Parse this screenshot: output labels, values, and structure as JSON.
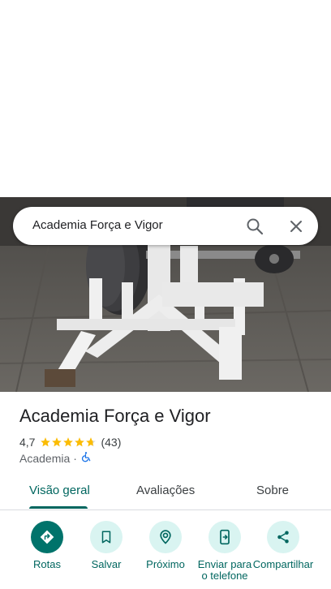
{
  "search": {
    "query": "Academia Força e Vigor"
  },
  "place": {
    "name": "Academia Força e Vigor",
    "rating": "4,7",
    "stars": 4.7,
    "reviews": "(43)",
    "category": "Academia",
    "separator": "·"
  },
  "tabs": [
    {
      "label": "Visão geral",
      "active": true
    },
    {
      "label": "Avaliações",
      "active": false
    },
    {
      "label": "Sobre",
      "active": false
    }
  ],
  "actions": [
    {
      "label": "Rotas",
      "icon": "directions-icon"
    },
    {
      "label": "Salvar",
      "icon": "bookmark-icon"
    },
    {
      "label": "Próximo",
      "icon": "nearby-icon"
    },
    {
      "label": "Enviar para o telefone",
      "icon": "send-to-phone-icon"
    },
    {
      "label": "Compartilhar",
      "icon": "share-icon"
    }
  ],
  "colors": {
    "accent": "#00665f",
    "primary_button": "#00736b",
    "button_bg": "#d9f4f1",
    "star": "#fbbc04"
  }
}
